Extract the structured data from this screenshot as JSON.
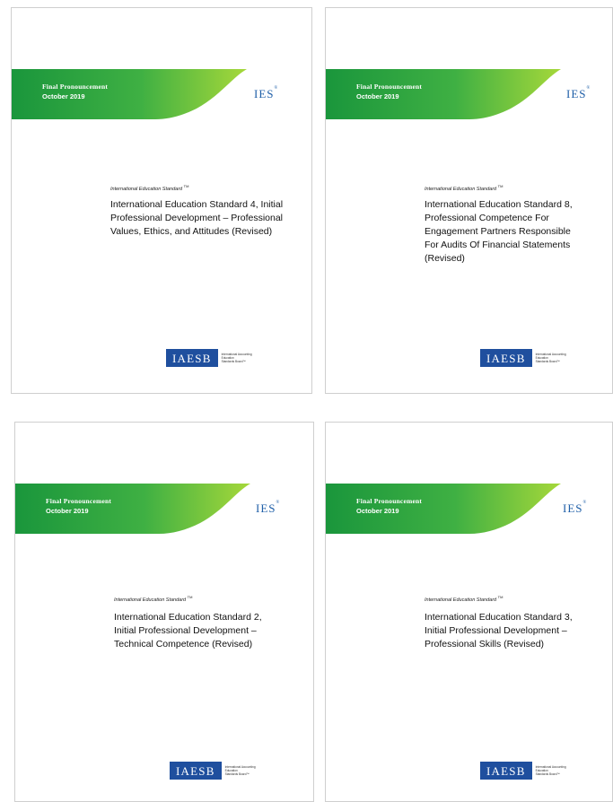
{
  "covers": [
    {
      "banner_line1": "Final Pronouncement",
      "banner_line2": "October 2019",
      "brand": "IES",
      "brand_mark": "®",
      "standard_label": "International Education Standard",
      "standard_mark": "TM",
      "title": "International Education Standard 4, Initial Professional Development – Professional Values, Ethics, and Attitudes (Revised)",
      "logo_text": "IAESB",
      "logo_line1": "International Accounting",
      "logo_line2": "Education",
      "logo_line3": "Standards Board™"
    },
    {
      "banner_line1": "Final Pronouncement",
      "banner_line2": "October 2019",
      "brand": "IES",
      "brand_mark": "®",
      "standard_label": "International Education Standard",
      "standard_mark": "TM",
      "title": "International Education Standard 8, Professional Competence For Engagement Partners Responsible For Audits Of Financial Statements (Revised)",
      "logo_text": "IAESB",
      "logo_line1": "International Accounting",
      "logo_line2": "Education",
      "logo_line3": "Standards Board™"
    },
    {
      "banner_line1": "Final Pronouncement",
      "banner_line2": "October 2019",
      "brand": "IES",
      "brand_mark": "®",
      "standard_label": "International Education Standard",
      "standard_mark": "TM",
      "title": "International Education Standard 2, Initial Professional Development – Technical Competence (Revised)",
      "logo_text": "IAESB",
      "logo_line1": "International Accounting",
      "logo_line2": "Education",
      "logo_line3": "Standards Board™"
    },
    {
      "banner_line1": "Final Pronouncement",
      "banner_line2": "October 2019",
      "brand": "IES",
      "brand_mark": "®",
      "standard_label": "International Education Standard",
      "standard_mark": "TM",
      "title": "International Education Standard 3, Initial Professional Development – Professional Skills (Revised)",
      "logo_text": "IAESB",
      "logo_line1": "International Accounting",
      "logo_line2": "Education",
      "logo_line3": "Standards Board™"
    }
  ],
  "colors": {
    "banner_dark": "#1e9a3e",
    "banner_light": "#9bd23a",
    "brand_blue": "#1f5fa8",
    "logo_blue": "#1f4f9e"
  }
}
